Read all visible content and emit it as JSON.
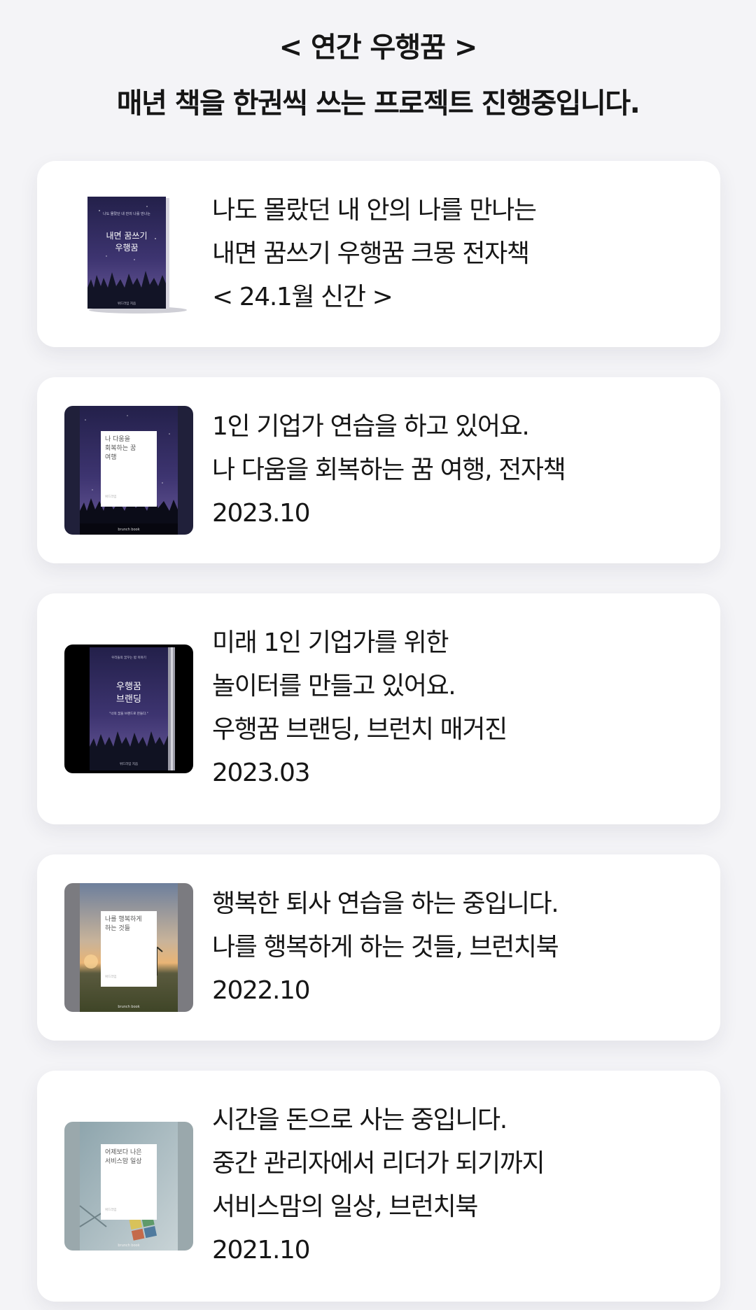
{
  "header": {
    "title": "< 연간 우행꿈 >",
    "subtitle": "매년 책을 한권씩 쓰는 프로젝트 진행중입니다."
  },
  "books": [
    {
      "lines": [
        "나도 몰랐던 내 안의 나를 만나는",
        "내면 꿈쓰기 우행꿈 크몽 전자책",
        "< 24.1월 신간 >"
      ],
      "cover": {
        "tagline": "나도 몰랐던 내 안의 나를 만나는",
        "title_1": "내면 꿈쓰기",
        "title_2": "우행꿈",
        "author": "위드라임 지음"
      }
    },
    {
      "lines": [
        "1인 기업가 연습을 하고 있어요.",
        "나 다움을 회복하는 꿈 여행, 전자책",
        "2023.10"
      ],
      "cover": {
        "title_1": "나 다움을",
        "title_2": "회복하는 꿈",
        "title_3": "여행",
        "author": "위드라임",
        "publisher": "brunch book"
      }
    },
    {
      "lines": [
        "미래 1인 기업가를 위한",
        "놀이터를 만들고 있어요.",
        "우행꿈 브랜딩, 브런치 매거진",
        "2023.03"
      ],
      "cover": {
        "tagline": "우리들의 꿈꾸는 밤 이야기",
        "title_1": "우행꿈",
        "title_2": "브랜딩",
        "quote": "\"너의 꿈을 브랜드로 만들다.\"",
        "author": "위드라임 지음"
      }
    },
    {
      "lines": [
        "행복한 퇴사 연습을 하는 중입니다.",
        "나를 행복하게 하는 것들, 브런치북",
        "2022.10"
      ],
      "cover": {
        "title_1": "나를 행복하게",
        "title_2": "하는 것들",
        "author": "위드라임",
        "publisher": "brunch book"
      }
    },
    {
      "lines": [
        "시간을 돈으로 사는 중입니다.",
        "중간 관리자에서 리더가 되기까지",
        "서비스맘의 일상, 브런치북",
        "2021.10"
      ],
      "cover": {
        "title_1": "어제보다 나은",
        "title_2": "서비스맘 일상",
        "author": "위드라임",
        "publisher": "brunch book"
      }
    }
  ]
}
